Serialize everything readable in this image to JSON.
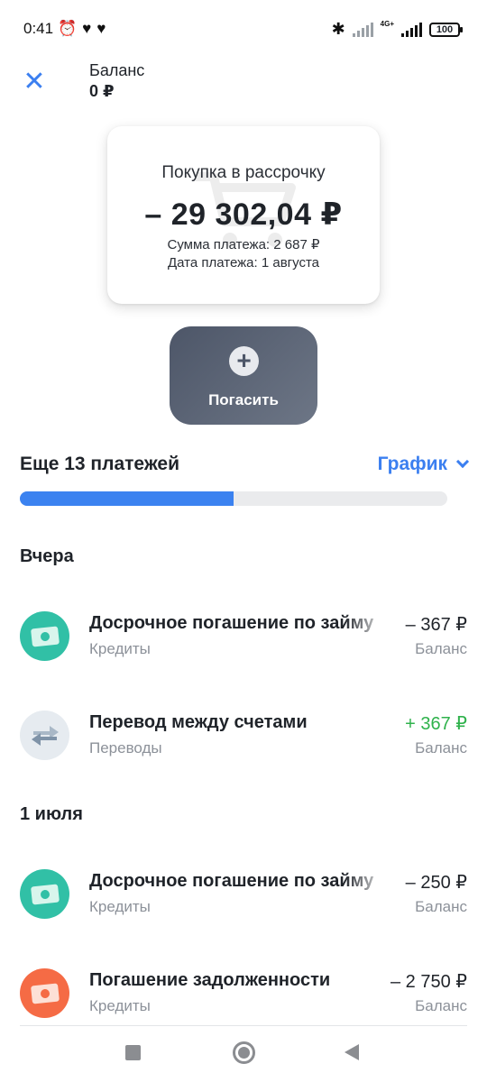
{
  "status_bar": {
    "time": "0:41",
    "left_icons": [
      "alarm-icon",
      "heart-icon",
      "heart-icon"
    ],
    "network_label": "4G+",
    "battery": "100"
  },
  "header": {
    "title": "Баланс",
    "balance": "0 ₽",
    "close_icon": "close-icon"
  },
  "card": {
    "title": "Покупка в рассрочку",
    "amount": "– 29 302,04 ₽",
    "payment_amount": "Сумма платежа: 2 687 ₽",
    "payment_date": "Дата платежа: 1 августа"
  },
  "pay_button": {
    "label": "Погасить",
    "icon": "plus-icon"
  },
  "payments": {
    "remaining_label": "Еще 13 платежей",
    "schedule_label": "График",
    "progress": 0.5,
    "accent": "#3b82f0"
  },
  "sections": [
    {
      "title": "Вчера",
      "items": [
        {
          "title": "Досрочное погашение по займу",
          "category": "Кредиты",
          "amount": "– 367 ₽",
          "account": "Баланс",
          "icon": "banknote-icon",
          "kind": "out"
        },
        {
          "title": "Перевод между счетами",
          "category": "Переводы",
          "amount": "+ 367 ₽",
          "account": "Баланс",
          "icon": "transfer-arrows-icon",
          "kind": "in"
        }
      ]
    },
    {
      "title": "1 июля",
      "items": [
        {
          "title": "Досрочное погашение по займу",
          "category": "Кредиты",
          "amount": "– 250 ₽",
          "account": "Баланс",
          "icon": "banknote-icon",
          "kind": "out"
        },
        {
          "title": "Погашение задолженности",
          "category": "Кредиты",
          "amount": "– 2 750 ₽",
          "account": "Баланс",
          "icon": "banknote-icon",
          "kind": "out"
        }
      ]
    }
  ],
  "nav_bar": [
    "recents-square-icon",
    "home-circle-icon",
    "back-triangle-icon"
  ]
}
